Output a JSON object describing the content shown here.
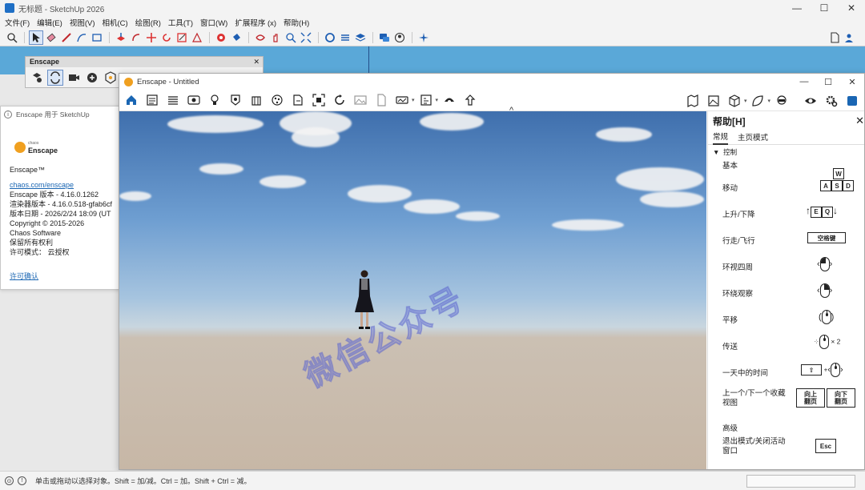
{
  "sketchup": {
    "title": "无标题 - SketchUp 2026",
    "menu": [
      "文件(F)",
      "编辑(E)",
      "视图(V)",
      "相机(C)",
      "绘图(R)",
      "工具(T)",
      "窗口(W)",
      "扩展程序 (x)",
      "帮助(H)"
    ],
    "status_text": "单击或拖动以选择对象。Shift = 加/减。Ctrl = 加。Shift + Ctrl = 减。"
  },
  "enscape_toolbar": {
    "title": "Enscape"
  },
  "about": {
    "header": "Enscape 用于 SketchUp",
    "logo_small": "chaos",
    "logo_name": "Enscape",
    "product": "Enscape™",
    "link": "chaos.com/enscape",
    "version": "Enscape 版本 - 4.16.0.1262",
    "renderer": "渲染器版本 - 4.16.0.518-gfab6cf",
    "date": "版本日期 - 2026/2/24 18:09 (UT",
    "copyright": "Copyright © 2015-2026",
    "company": "Chaos Software",
    "rights": "保留所有权利",
    "license_mode": "许可模式：  云授权",
    "license_link": "许可确认"
  },
  "enscape_window": {
    "title": "Enscape - Untitled"
  },
  "watermark": "微信公众号",
  "help": {
    "title": "帮助[H]",
    "tabs": [
      "常规",
      "主页模式"
    ],
    "section_controls": "控制",
    "basic": "基本",
    "rows": [
      {
        "label": "移动",
        "keys": [
          "W",
          "A",
          "S",
          "D"
        ]
      },
      {
        "label": "上升/下降",
        "keys": [
          "E",
          "Q"
        ]
      },
      {
        "label": "行走/飞行",
        "keys": [
          "空格键"
        ]
      },
      {
        "label": "环视四周"
      },
      {
        "label": "环绕观察"
      },
      {
        "label": "平移"
      },
      {
        "label": "传送",
        "suffix": "× 2"
      },
      {
        "label": "一天中的时间"
      },
      {
        "label_1": "上一个/下一个收藏",
        "label_2": "视图",
        "btn_up_1": "向上",
        "btn_up_2": "翻页",
        "btn_dn_1": "向下",
        "btn_dn_2": "翻页"
      }
    ],
    "advanced": "高级",
    "exit_label_1": "退出模式/关闭活动",
    "exit_label_2": "窗口",
    "exit_key": "Esc"
  },
  "colors": {
    "sky": "#5aa8d8",
    "accent": "#1a66b3",
    "enscape_orange": "#f0a020"
  }
}
